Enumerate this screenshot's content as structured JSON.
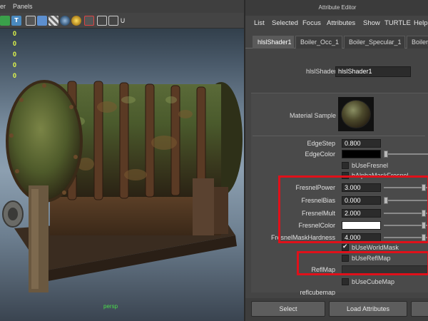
{
  "viewport": {
    "menu": [
      "er",
      "Panels"
    ],
    "hud_values": [
      "0",
      "0",
      "0",
      "0",
      "0"
    ],
    "camera_label": "persp"
  },
  "editor": {
    "title": "Attribute Editor",
    "menu": [
      "List",
      "Selected",
      "Focus",
      "Attributes",
      "Show",
      "TURTLE",
      "Help"
    ],
    "tabs": [
      "hlslShader1",
      "Boiler_Occ_1",
      "Boiler_Specular_1",
      "Boiler_"
    ],
    "shader_label": "hlslShader:",
    "shader_name": "hlslShader1",
    "material_sample_label": "Material Sample",
    "attrs": {
      "edge_step_label": "EdgeStep",
      "edge_step_value": "0.800",
      "edge_color_label": "EdgeColor",
      "use_fresnel_label": "bUseFresnel",
      "alpha_mask_fresnel_label": "bAlphaMaskFresnel",
      "fresnel_power_label": "FresnelPower",
      "fresnel_power_value": "3.000",
      "fresnel_bias_label": "FresnelBias",
      "fresnel_bias_value": "0.000",
      "fresnel_mult_label": "FresnelMult",
      "fresnel_mult_value": "2.000",
      "fresnel_color_label": "FresnelColor",
      "fresnel_mask_hardness_label": "FresnelMaskHardness",
      "fresnel_mask_hardness_value": "4.000",
      "use_world_mask_label": "bUseWorldMask",
      "use_refl_map_label": "bUseReflMap",
      "refl_map_label": "ReflMap",
      "use_cube_map_label": "bUseCubeMap",
      "refl_cubemap_label": "reflcubemap"
    },
    "buttons": {
      "select": "Select",
      "load_attributes": "Load Attributes"
    },
    "colors": {
      "highlight": "#e0101a",
      "edge_color": "#000000",
      "fresnel_color": "#ffffff"
    }
  }
}
